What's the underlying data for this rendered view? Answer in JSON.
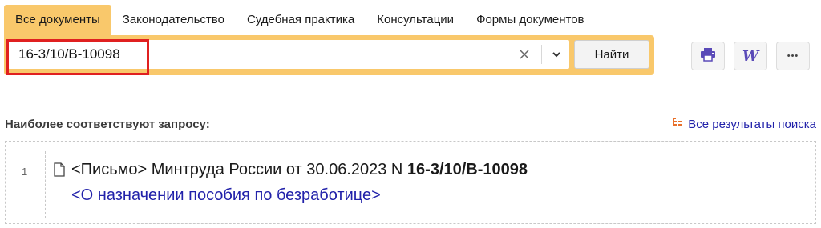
{
  "tabs": [
    {
      "label": "Все документы",
      "active": true
    },
    {
      "label": "Законодательство",
      "active": false
    },
    {
      "label": "Судебная практика",
      "active": false
    },
    {
      "label": "Консультации",
      "active": false
    },
    {
      "label": "Формы документов",
      "active": false
    }
  ],
  "search": {
    "value": "16-3/10/В-10098",
    "find_label": "Найти"
  },
  "toolbar": {
    "print_icon": "printer-icon",
    "word_icon": "word-export-icon",
    "word_label": "W",
    "more_label": "•••"
  },
  "results": {
    "heading": "Наиболее соответствуют запросу:",
    "all_results_label": "Все результаты поиска",
    "items": [
      {
        "number": "1",
        "prefix": "<Письмо> Минтруда России от 30.06.2023 N ",
        "number_bold": "16-3/10/В-10098",
        "title": "<О назначении пособия по безработице>"
      }
    ]
  },
  "colors": {
    "accent": "#f9c86b",
    "link": "#2222aa",
    "highlight": "#e02020",
    "bullet": "#e8702a"
  }
}
